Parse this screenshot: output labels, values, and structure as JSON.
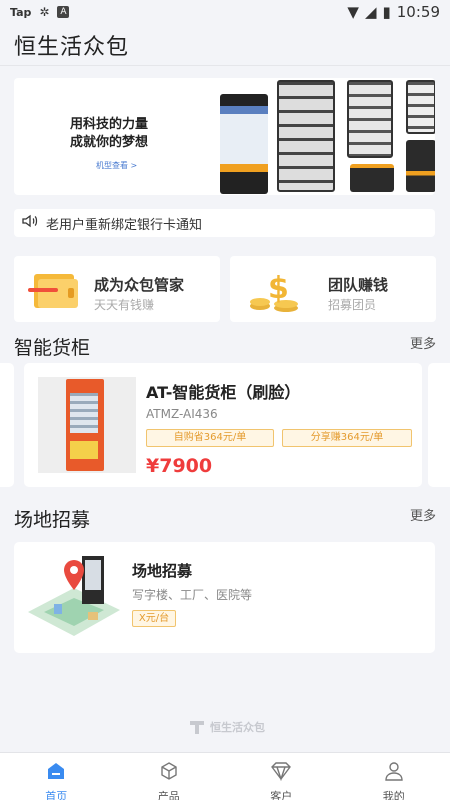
{
  "status_bar": {
    "carrier": "Tap",
    "time": "10:59",
    "box_letter": "A"
  },
  "app": {
    "title": "恒生活众包"
  },
  "banner": {
    "headline_1": "用科技的力量",
    "headline_2": "成就你的梦想",
    "link": "机型查看 >"
  },
  "notice": {
    "text": "老用户重新绑定银行卡通知",
    "icon": "speaker-icon"
  },
  "quick_cards": [
    {
      "title": "成为众包管家",
      "subtitle": "天天有钱赚",
      "icon": "folder-icon"
    },
    {
      "title": "团队赚钱",
      "subtitle": "招募团员",
      "icon": "money-icon"
    }
  ],
  "smart_cabinet": {
    "section_title": "智能货柜",
    "more": "更多",
    "product": {
      "title": "AT-智能货柜（刷脸）",
      "code": "ATMZ-AI436",
      "tag_self": "自购省364元/单",
      "tag_share": "分享赚364元/单",
      "price": "¥7900"
    }
  },
  "site_recruit": {
    "section_title": "场地招募",
    "more": "更多",
    "item": {
      "title": "场地招募",
      "subtitle": "写字楼、工厂、医院等",
      "tag": "X元/台"
    }
  },
  "footer": {
    "brand": "恒生活众包"
  },
  "tabbar": {
    "items": [
      {
        "label": "首页",
        "icon": "home-icon",
        "active": true
      },
      {
        "label": "产品",
        "icon": "box-icon",
        "active": false
      },
      {
        "label": "客户",
        "icon": "diamond-icon",
        "active": false
      },
      {
        "label": "我的",
        "icon": "user-icon",
        "active": false
      }
    ]
  },
  "colors": {
    "accent": "#3a8bf0",
    "price": "#ef3c3c",
    "tag": "#e49b2e"
  }
}
